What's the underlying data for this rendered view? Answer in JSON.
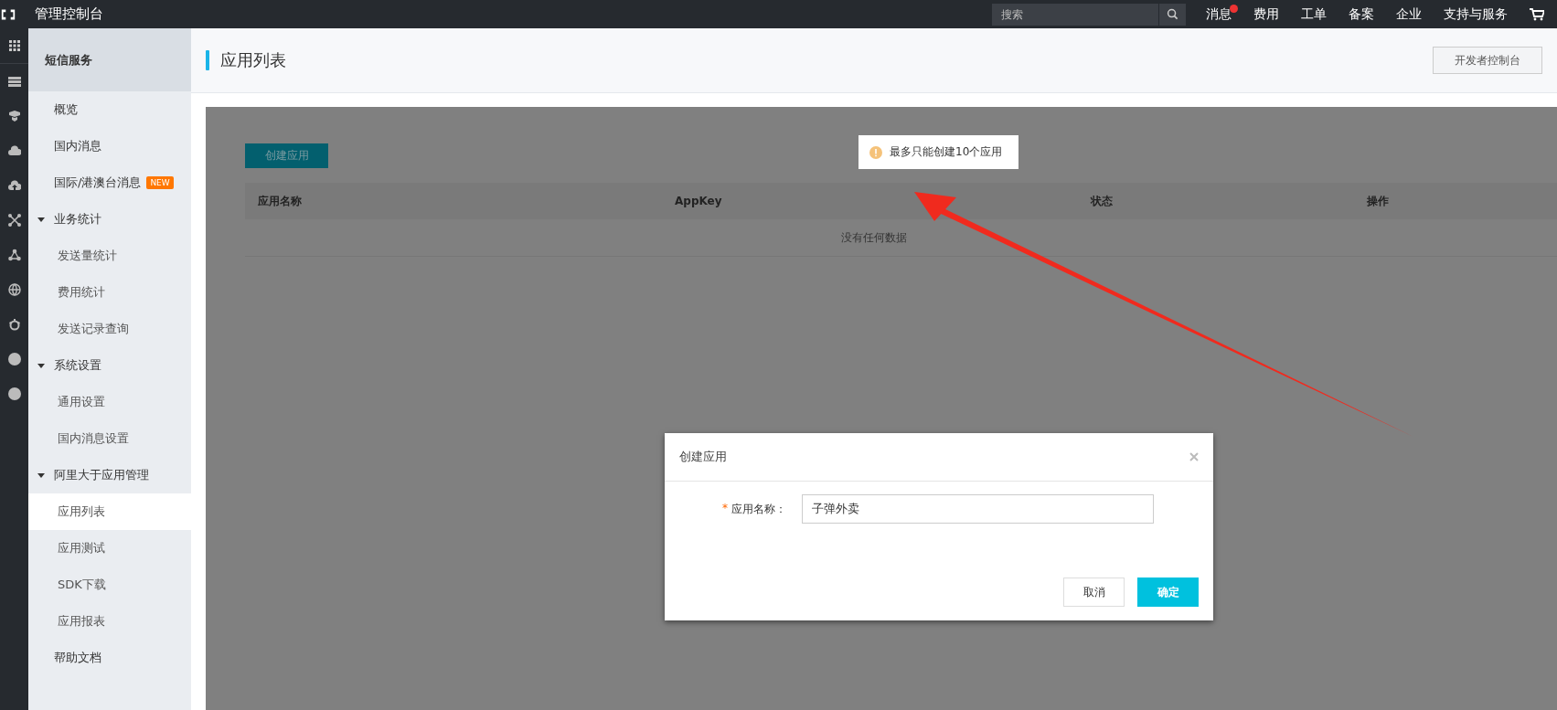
{
  "topbar": {
    "title": "管理控制台",
    "search": {
      "placeholder": "搜索"
    },
    "nav": [
      {
        "label": "消息",
        "badge": true
      },
      {
        "label": "费用",
        "badge": false
      },
      {
        "label": "工单",
        "badge": false
      },
      {
        "label": "备案",
        "badge": false
      },
      {
        "label": "企业",
        "badge": false
      },
      {
        "label": "支持与服务",
        "badge": false
      }
    ]
  },
  "sidebar": {
    "title": "短信服务",
    "items": [
      {
        "label": "概览",
        "selected": false
      },
      {
        "label": "国内消息",
        "selected": false
      },
      {
        "label": "国际/港澳台消息",
        "selected": false,
        "tag": "NEW"
      },
      {
        "label": "业务统计",
        "expanded": true,
        "children": [
          {
            "label": "发送量统计",
            "selected": false
          },
          {
            "label": "费用统计",
            "selected": false
          },
          {
            "label": "发送记录查询",
            "selected": false
          }
        ]
      },
      {
        "label": "系统设置",
        "expanded": true,
        "children": [
          {
            "label": "通用设置",
            "selected": false
          },
          {
            "label": "国内消息设置",
            "selected": false
          }
        ]
      },
      {
        "label": "阿里大于应用管理",
        "expanded": true,
        "children": [
          {
            "label": "应用列表",
            "selected": true
          },
          {
            "label": "应用测试",
            "selected": false
          },
          {
            "label": "SDK下载",
            "selected": false
          },
          {
            "label": "应用报表",
            "selected": false
          }
        ]
      },
      {
        "label": "帮助文档",
        "selected": false
      }
    ]
  },
  "page": {
    "title": "应用列表",
    "header_button": "开发者控制台",
    "create_button": "创建应用",
    "table": {
      "columns": [
        "应用名称",
        "AppKey",
        "状态",
        "操作"
      ],
      "empty_text": "没有任何数据"
    }
  },
  "toast": {
    "text": "最多只能创建10个应用"
  },
  "dialog": {
    "title": "创建应用",
    "fields": [
      {
        "label": "应用名称：",
        "required_mark": "*",
        "value": "子弹外卖"
      }
    ],
    "buttons": [
      {
        "label": "取消",
        "kind": "secondary"
      },
      {
        "label": "确定",
        "kind": "primary"
      }
    ]
  }
}
